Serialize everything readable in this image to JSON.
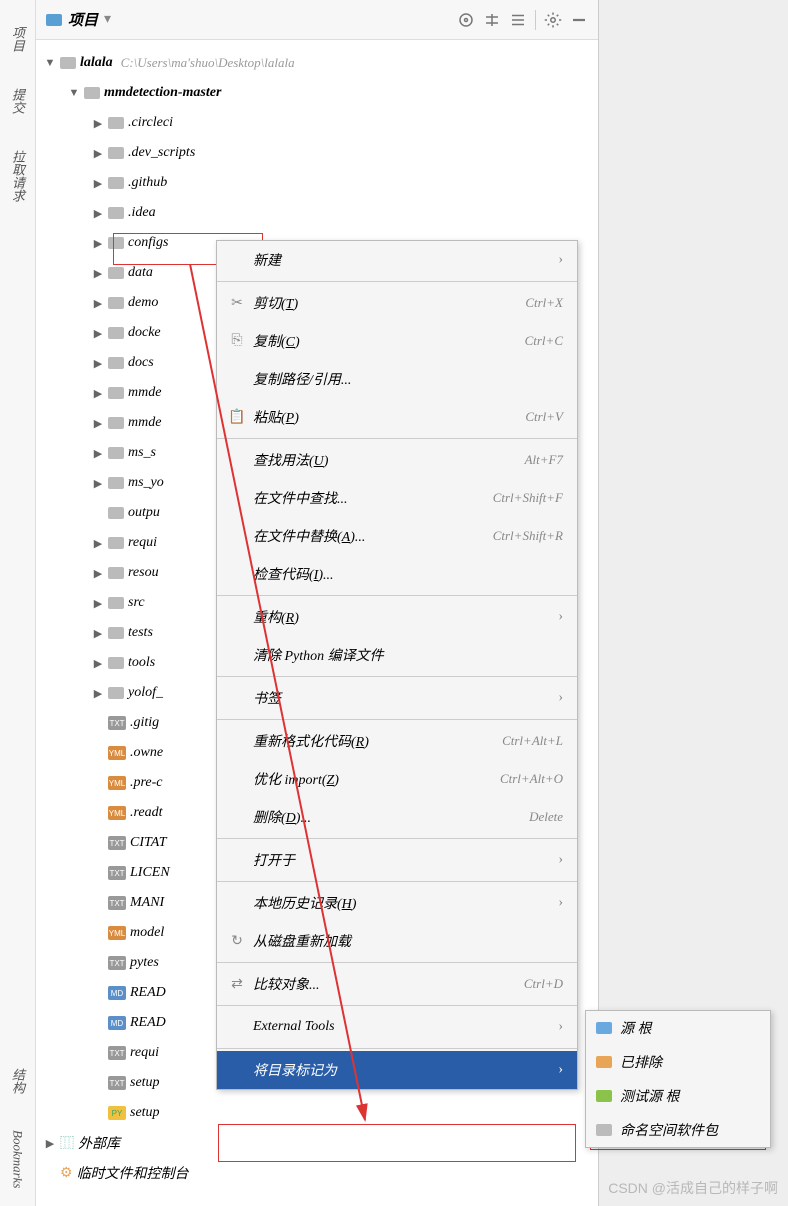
{
  "rail": {
    "project": "项目",
    "commit": "提交",
    "pull": "拉取请求",
    "structure": "结构",
    "bookmarks": "Bookmarks"
  },
  "toolbar": {
    "title": "项目"
  },
  "tree": {
    "root": {
      "name": "lalala",
      "path": "C:\\Users\\ma'shuo\\Desktop\\lalala"
    },
    "l1": {
      "name": "mmdetection-master"
    },
    "folders": [
      ".circleci",
      ".dev_scripts",
      ".github",
      ".idea",
      "configs",
      "data",
      "demo",
      "docker",
      "docs",
      "mmdet",
      "mmdet",
      "ms_s",
      "ms_yo",
      "output",
      "requirements",
      "resources",
      "src",
      "tests",
      "tools",
      "yolof_"
    ],
    "folder_display": [
      ".circleci",
      ".dev_scripts",
      ".github",
      ".idea",
      "configs",
      "data",
      "demo",
      "docke",
      "docs",
      "mmde",
      "mmde",
      "ms_s",
      "ms_yo",
      "outpu",
      "requi",
      "resou",
      "src",
      "tests",
      "tools",
      "yolof_"
    ],
    "files": [
      {
        "name": ".gitignore",
        "disp": ".gitig",
        "badge": "txt"
      },
      {
        "name": ".owner",
        "disp": ".owne",
        "badge": "yml"
      },
      {
        "name": ".pre-commit",
        "disp": ".pre-c",
        "badge": "yml"
      },
      {
        "name": ".readthedocs",
        "disp": ".readt",
        "badge": "yml"
      },
      {
        "name": "CITATION",
        "disp": "CITAT",
        "badge": "txt"
      },
      {
        "name": "LICENSE",
        "disp": "LICEN",
        "badge": "txt"
      },
      {
        "name": "MANIFEST",
        "disp": "MANI",
        "badge": "txt"
      },
      {
        "name": "model",
        "disp": "model",
        "badge": "yml"
      },
      {
        "name": "pytest",
        "disp": "pytes",
        "badge": "txt"
      },
      {
        "name": "README",
        "disp": "READ",
        "badge": "md"
      },
      {
        "name": "README",
        "disp": "READ",
        "badge": "md"
      },
      {
        "name": "requirements",
        "disp": "requi",
        "badge": "txt"
      },
      {
        "name": "setup",
        "disp": "setup",
        "badge": "txt"
      },
      {
        "name": "setup",
        "disp": "setup",
        "badge": "py"
      }
    ],
    "extlib": "外部库",
    "scratch": "临时文件和控制台"
  },
  "context_menu": [
    {
      "type": "item",
      "label": "新建",
      "sub": true
    },
    {
      "type": "sep"
    },
    {
      "type": "item",
      "icon": "✂",
      "label": "剪切",
      "u": "T",
      "short": "Ctrl+X"
    },
    {
      "type": "item",
      "icon": "⎘",
      "label": "复制",
      "u": "C",
      "short": "Ctrl+C"
    },
    {
      "type": "item",
      "label": "复制路径/引用..."
    },
    {
      "type": "item",
      "icon": "📋",
      "label": "粘贴",
      "u": "P",
      "short": "Ctrl+V"
    },
    {
      "type": "sep"
    },
    {
      "type": "item",
      "label": "查找用法",
      "u": "U",
      "short": "Alt+F7"
    },
    {
      "type": "item",
      "label": "在文件中查找...",
      "short": "Ctrl+Shift+F"
    },
    {
      "type": "item",
      "label": "在文件中替换",
      "u": "A",
      "tail": "...",
      "short": "Ctrl+Shift+R"
    },
    {
      "type": "item",
      "label": "检查代码",
      "u": "I",
      "tail": "..."
    },
    {
      "type": "sep"
    },
    {
      "type": "item",
      "label": "重构",
      "u": "R",
      "sub": true
    },
    {
      "type": "item",
      "label": "清除 Python 编译文件"
    },
    {
      "type": "sep"
    },
    {
      "type": "item",
      "label": "书签",
      "sub": true
    },
    {
      "type": "sep"
    },
    {
      "type": "item",
      "label": "重新格式化代码",
      "u": "R",
      "short": "Ctrl+Alt+L"
    },
    {
      "type": "item",
      "label": "优化 import",
      "u": "Z",
      "short": "Ctrl+Alt+O"
    },
    {
      "type": "item",
      "label": "删除",
      "u": "D",
      "tail": "...",
      "short": "Delete"
    },
    {
      "type": "sep"
    },
    {
      "type": "item",
      "label": "打开于",
      "sub": true
    },
    {
      "type": "sep"
    },
    {
      "type": "item",
      "label": "本地历史记录",
      "u": "H",
      "sub": true
    },
    {
      "type": "item",
      "icon": "↻",
      "label": "从磁盘重新加载"
    },
    {
      "type": "sep"
    },
    {
      "type": "item",
      "icon": "⇄",
      "label": "比较对象...",
      "short": "Ctrl+D"
    },
    {
      "type": "sep"
    },
    {
      "type": "item",
      "label": "External Tools",
      "sub": true
    },
    {
      "type": "sep"
    },
    {
      "type": "item",
      "label": "将目录标记为",
      "sub": true,
      "selected": true
    }
  ],
  "submenu": [
    {
      "color": "blue",
      "label": "源 根"
    },
    {
      "color": "orange",
      "label": "已排除"
    },
    {
      "color": "green",
      "label": "测试源 根"
    },
    {
      "color": "grey",
      "label": "命名空间软件包"
    }
  ],
  "watermark": "CSDN @活成自己的样子啊"
}
